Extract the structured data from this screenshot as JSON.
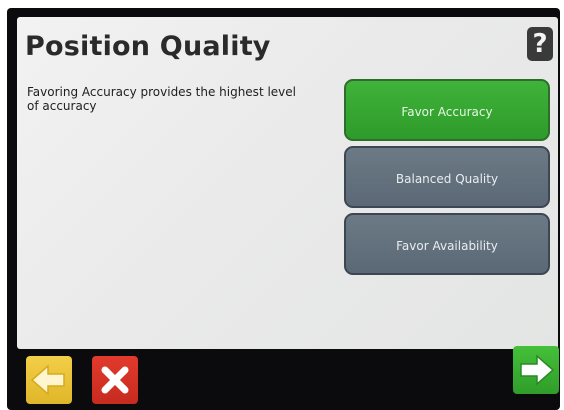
{
  "screen": {
    "title": "Position Quality",
    "help_label": "?",
    "description": "Favoring Accuracy provides the highest level of accuracy"
  },
  "options": [
    {
      "label": "Favor Accuracy",
      "selected": true
    },
    {
      "label": "Balanced Quality",
      "selected": false
    },
    {
      "label": "Favor Availability",
      "selected": false
    }
  ],
  "nav": {
    "back_icon": "arrow-left-icon",
    "cancel_icon": "close-icon",
    "next_icon": "arrow-right-icon"
  },
  "colors": {
    "selected": "#3aa935",
    "unselected": "#647280",
    "back": "#e8c23a",
    "cancel": "#d63426",
    "next": "#3cb232"
  }
}
